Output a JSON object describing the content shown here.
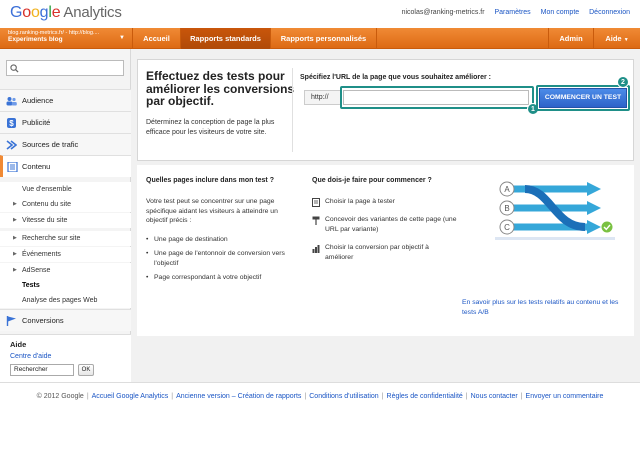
{
  "topbar": {
    "logo_google": [
      "G",
      "o",
      "o",
      "g",
      "l",
      "e"
    ],
    "logo_product": "Analytics",
    "user_email": "nicolas@ranking-metrics.fr",
    "links": [
      "Paramètres",
      "Mon compte",
      "Déconnexion"
    ]
  },
  "navbar": {
    "account_line1": "blog.ranking-metrics.fr/ - http://blog....",
    "account_line2": "Experiments blog",
    "tabs": [
      "Accueil",
      "Rapports standards",
      "Rapports personnalisés"
    ],
    "right_tabs": [
      "Admin",
      "Aide"
    ],
    "active_tab": "Rapports standards"
  },
  "sidebar": {
    "search_placeholder": "",
    "sections": [
      {
        "label": "Audience",
        "icon": "audience-icon"
      },
      {
        "label": "Publicité",
        "icon": "publicite-icon"
      },
      {
        "label": "Sources de trafic",
        "icon": "traffic-sources-icon"
      },
      {
        "label": "Contenu",
        "icon": "content-icon",
        "active": true
      }
    ],
    "content_items": [
      {
        "label": "Vue d'ensemble",
        "arrow": false
      },
      {
        "label": "Contenu du site",
        "arrow": true
      },
      {
        "label": "Vitesse du site",
        "arrow": true
      },
      {
        "label": "Recherche sur site",
        "arrow": true
      },
      {
        "label": "Événements",
        "arrow": true
      },
      {
        "label": "AdSense",
        "arrow": true
      },
      {
        "label": "Tests",
        "arrow": false,
        "selected": true
      },
      {
        "label": "Analyse des pages Web",
        "arrow": false
      }
    ],
    "conversions": {
      "label": "Conversions",
      "icon": "flag-icon"
    },
    "help": {
      "title": "Aide",
      "link": "Centre d'aide",
      "search_value": "Rechercher",
      "ok_label": "OK"
    }
  },
  "hero": {
    "title": "Effectuez des tests pour améliorer les conversions par objectif.",
    "description": "Déterminez la conception de page la plus efficace pour les visiteurs de votre site.",
    "url_label": "Spécifiez l'URL de la page que vous souhaitez améliorer :",
    "url_prefix": "http://",
    "url_value": "",
    "start_button": "COMMENCER UN TEST",
    "callouts": [
      "1",
      "2"
    ]
  },
  "info": {
    "col1_title": "Quelles pages inclure dans mon test ?",
    "col1_intro": "Votre test peut se concentrer sur une page spécifique aidant les visiteurs à atteindre un objectif précis :",
    "col1_items": [
      "Une page de destination",
      "Une page de l'entonnoir de conversion vers l'objectif",
      "Page correspondant à votre objectif"
    ],
    "col2_title": "Que dois-je faire pour commencer ?",
    "col2_steps": [
      "Choisir la page à tester",
      "Concevoir des variantes de cette page (une URL par variante)",
      "Choisir la conversion par objectif à améliorer"
    ],
    "illustration_labels": [
      "A",
      "B",
      "C"
    ],
    "ab_link": "En savoir plus sur les tests relatifs au contenu et les tests A/B"
  },
  "footer": {
    "copyright": "© 2012 Google",
    "links": [
      "Accueil Google Analytics",
      "Ancienne version – Création de rapports",
      "Conditions d'utilisation",
      "Règles de confidentialité",
      "Nous contacter",
      "Envoyer un commentaire"
    ]
  },
  "colors": {
    "brand_orange": "#e8772a",
    "active_tab": "#b84d09",
    "button_blue": "#3a73d6",
    "highlight_teal": "#1f8f88",
    "link_blue": "#1a55c4"
  }
}
